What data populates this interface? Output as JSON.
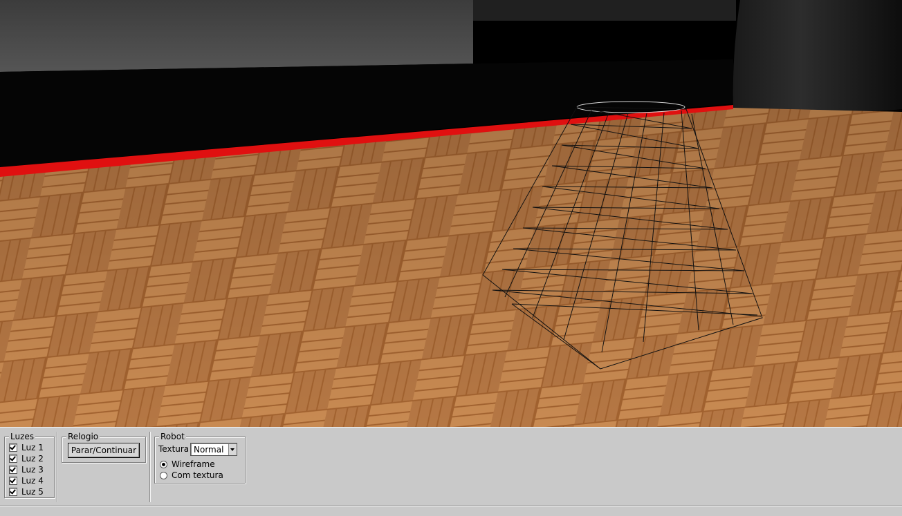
{
  "lights": {
    "title": "Luzes",
    "items": [
      {
        "label": "Luz 1",
        "checked": true
      },
      {
        "label": "Luz 2",
        "checked": true
      },
      {
        "label": "Luz 3",
        "checked": true
      },
      {
        "label": "Luz 4",
        "checked": true
      },
      {
        "label": "Luz 5",
        "checked": true
      }
    ]
  },
  "clock": {
    "title": "Relogio",
    "button_label": "Parar/Continuar"
  },
  "robot": {
    "title": "Robot",
    "texture_label": "Textura",
    "texture_value": "Normal",
    "modes": [
      {
        "label": "Wireframe",
        "selected": true
      },
      {
        "label": "Com textura",
        "selected": false
      }
    ]
  },
  "scene": {
    "floor_color": "#9a5f2e",
    "border_color": "#e01010",
    "background_color": "#000000"
  }
}
